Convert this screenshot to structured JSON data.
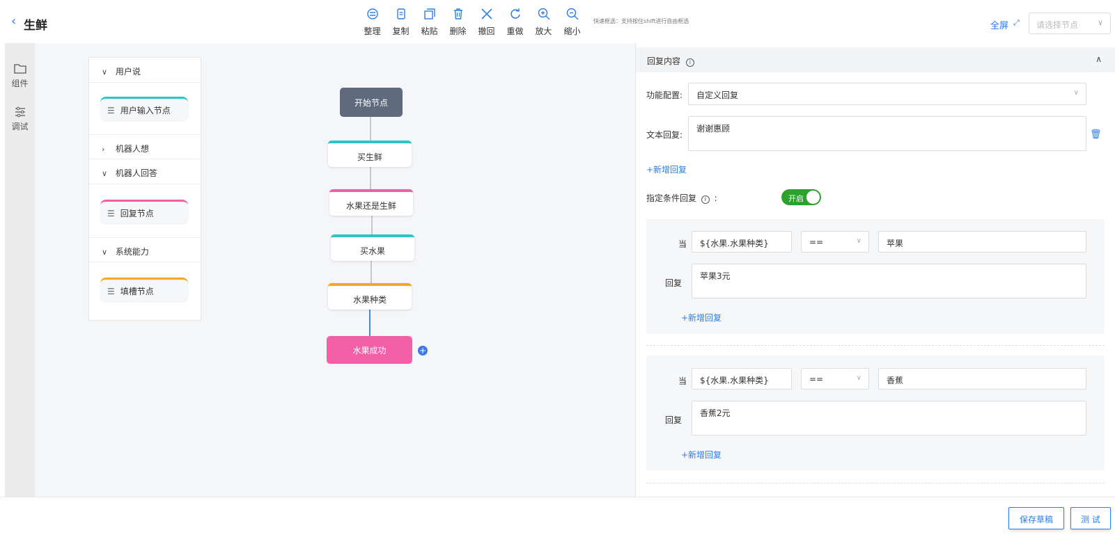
{
  "header": {
    "back_icon": "chevron-left-icon",
    "title": "生鲜",
    "fullscreen_label": "全屏",
    "node_select_placeholder": "请选择节点"
  },
  "toolbar": {
    "items": [
      {
        "label": "整理",
        "icon": "organize-icon"
      },
      {
        "label": "复制",
        "icon": "copy-icon"
      },
      {
        "label": "粘贴",
        "icon": "paste-icon"
      },
      {
        "label": "删除",
        "icon": "delete-icon"
      },
      {
        "label": "撤回",
        "icon": "undo-icon"
      },
      {
        "label": "重做",
        "icon": "redo-icon"
      },
      {
        "label": "放大",
        "icon": "zoom-in-icon"
      },
      {
        "label": "缩小",
        "icon": "zoom-out-icon"
      }
    ],
    "hint": "快速框选：支持按住shift进行自由框选"
  },
  "leftbar": {
    "components_label": "组件",
    "debug_label": "调试"
  },
  "palette": {
    "sections": [
      {
        "label": "用户说",
        "expanded": true,
        "node": {
          "label": "用户输入节点",
          "color": "#2ec4c8"
        }
      },
      {
        "label": "机器人想",
        "expanded": false
      },
      {
        "label": "机器人回答",
        "expanded": true,
        "node": {
          "label": "回复节点",
          "color": "#f05fa6"
        }
      },
      {
        "label": "系统能力",
        "expanded": true,
        "node": {
          "label": "填槽节点",
          "color": "#f5a623"
        }
      }
    ]
  },
  "flow": {
    "start": "开始节点",
    "nodes": [
      {
        "label": "买生鲜",
        "color": "#2ec4c8"
      },
      {
        "label": "水果还是生鲜",
        "color": "#f05fa6"
      },
      {
        "label": "买水果",
        "color": "#2ec4c8"
      },
      {
        "label": "水果种类",
        "color": "#f5a623"
      }
    ],
    "end": "水果成功",
    "end_color": "#f45fa8"
  },
  "reply_panel": {
    "title": "回复内容",
    "func_label": "功能配置:",
    "func_value": "自定义回复",
    "text_label": "文本回复:",
    "text_value": "谢谢惠顾",
    "add_reply": "+新增回复",
    "cond_label": "指定条件回复",
    "cond_colon": ":",
    "toggle_label": "开启",
    "conditions": [
      {
        "when": "当",
        "var": "${水果.水果种类}",
        "op": "==",
        "value": "苹果",
        "reply_label": "回复",
        "reply": "苹果3元",
        "add": "+新增回复"
      },
      {
        "when": "当",
        "var": "${水果.水果种类}",
        "op": "==",
        "value": "香蕉",
        "reply_label": "回复",
        "reply": "香蕉2元",
        "add": "+新增回复"
      }
    ]
  },
  "footer": {
    "save_draft": "保存草稿",
    "test": "测 试"
  },
  "colors": {
    "accent": "#2b7de9",
    "toggle_on": "#2ca12c"
  }
}
